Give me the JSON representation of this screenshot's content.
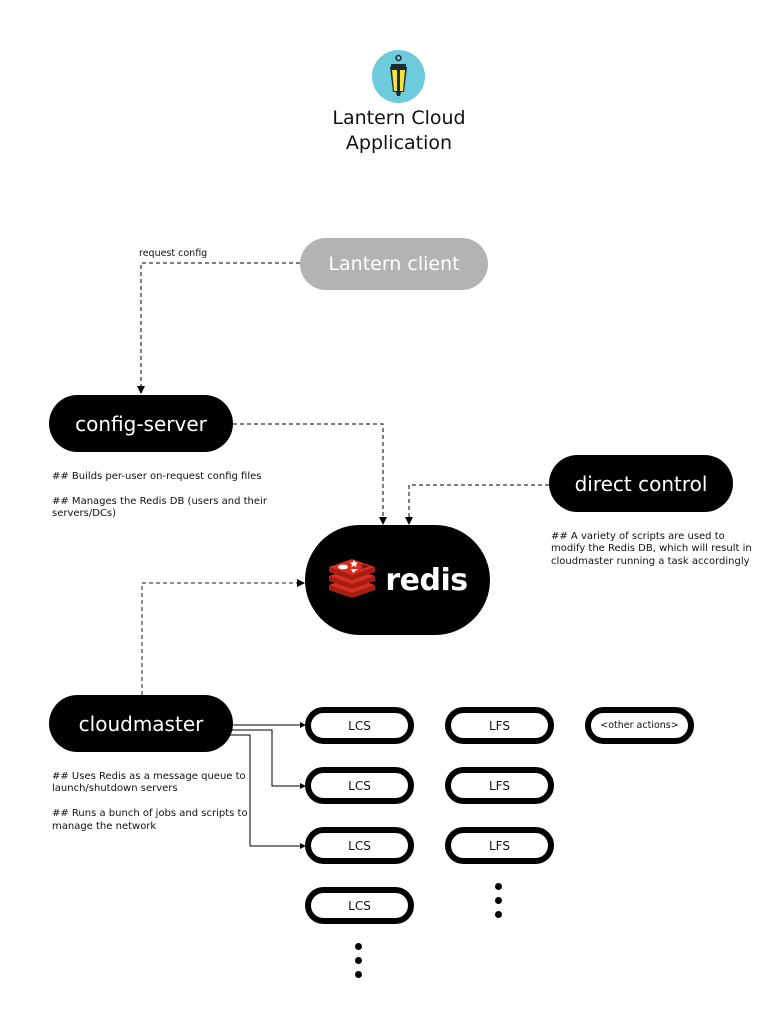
{
  "header": {
    "logo_icon": "lantern-icon",
    "title_line1": "Lantern Cloud",
    "title_line2": "Application"
  },
  "colors": {
    "logo_bg": "#6ecbdc",
    "logo_glow": "#f4e23a",
    "client_pill": "#b3b3b3",
    "node_fill": "#000000",
    "redis_red": "#d82c20",
    "dashed_line": "#555555"
  },
  "nodes": {
    "client": {
      "label": "Lantern client"
    },
    "config_server": {
      "label": "config-server",
      "notes": [
        "## Builds per-user on-request config files",
        "## Manages the Redis DB (users and their servers/DCs)"
      ]
    },
    "direct_control": {
      "label": "direct control",
      "notes": [
        "## A variety of scripts are used to modify the Redis DB, which will result in cloudmaster running a task accordingly"
      ]
    },
    "redis": {
      "label": "redis",
      "icon": "redis-logo-icon"
    },
    "cloudmaster": {
      "label": "cloudmaster",
      "notes": [
        "## Uses Redis as a message queue to launch/shutdown servers",
        "## Runs a bunch of jobs and scripts to manage the network"
      ]
    }
  },
  "edges": {
    "request_config_label": "request config"
  },
  "workers": {
    "lcs": [
      "LCS",
      "LCS",
      "LCS",
      "LCS"
    ],
    "lfs": [
      "LFS",
      "LFS",
      "LFS"
    ],
    "other": "<other actions>"
  }
}
